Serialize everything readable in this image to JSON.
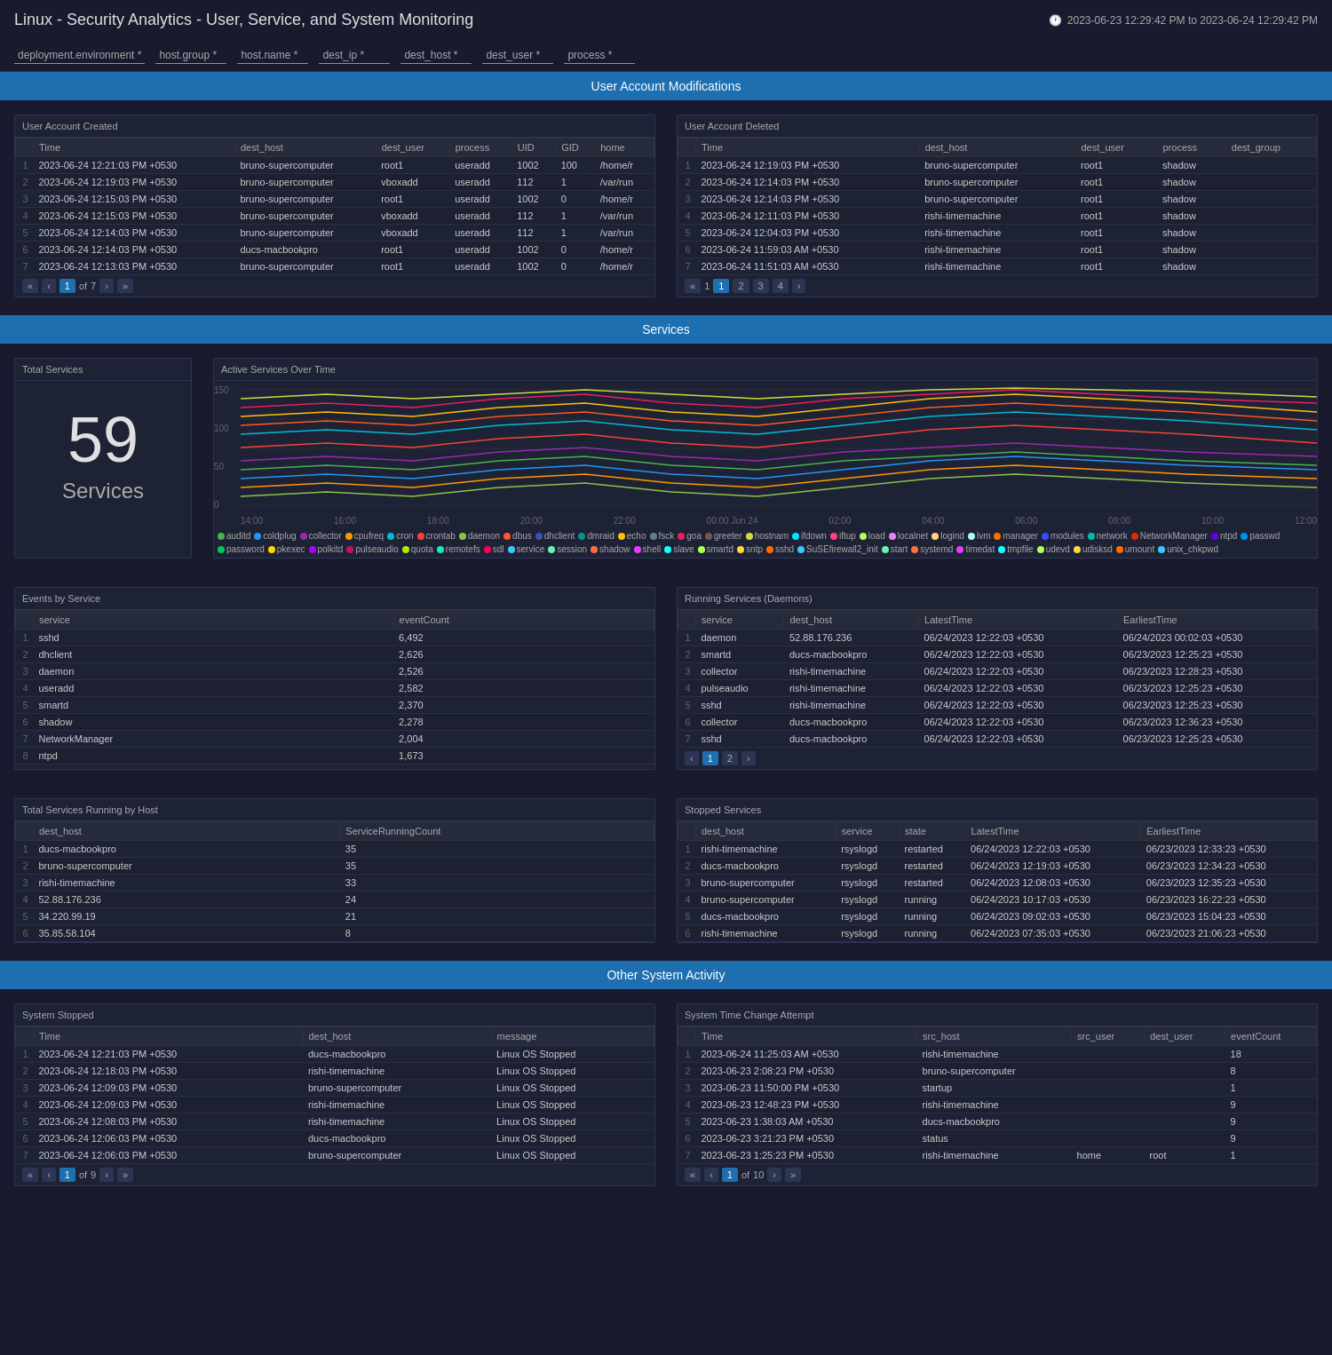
{
  "header": {
    "title": "Linux - Security Analytics - User, Service, and System Monitoring",
    "time_range": "2023-06-23 12:29:42 PM to 2023-06-24 12:29:42 PM"
  },
  "filters": [
    {
      "label": "deployment.environment *",
      "value": ""
    },
    {
      "label": "host.group *",
      "value": ""
    },
    {
      "label": "host.name *",
      "value": ""
    },
    {
      "label": "dest_ip *",
      "value": ""
    },
    {
      "label": "dest_host *",
      "value": ""
    },
    {
      "label": "dest_user *",
      "value": ""
    },
    {
      "label": "process *",
      "value": ""
    }
  ],
  "sections": {
    "user_account": {
      "title": "User Account Modifications",
      "created": {
        "title": "User Account Created",
        "columns": [
          "Time",
          "dest_host",
          "dest_user",
          "process",
          "UID",
          "GID",
          "home"
        ],
        "rows": [
          [
            "2023-06-24 12:21:03 PM +0530",
            "bruno-supercomputer",
            "root1",
            "useradd",
            "1002",
            "100",
            "/home/r"
          ],
          [
            "2023-06-24 12:19:03 PM +0530",
            "bruno-supercomputer",
            "vboxadd",
            "useradd",
            "112",
            "1",
            "/var/run"
          ],
          [
            "2023-06-24 12:15:03 PM +0530",
            "bruno-supercomputer",
            "root1",
            "useradd",
            "1002",
            "0",
            "/home/r"
          ],
          [
            "2023-06-24 12:15:03 PM +0530",
            "bruno-supercomputer",
            "vboxadd",
            "useradd",
            "112",
            "1",
            "/var/run"
          ],
          [
            "2023-06-24 12:14:03 PM +0530",
            "bruno-supercomputer",
            "vboxadd",
            "useradd",
            "112",
            "1",
            "/var/run"
          ],
          [
            "2023-06-24 12:14:03 PM +0530",
            "ducs-macbookpro",
            "root1",
            "useradd",
            "1002",
            "0",
            "/home/r"
          ],
          [
            "2023-06-24 12:13:03 PM +0530",
            "bruno-supercomputer",
            "root1",
            "useradd",
            "1002",
            "0",
            "/home/r"
          ]
        ],
        "pagination": {
          "current": 1,
          "total": 7
        }
      },
      "deleted": {
        "title": "User Account Deleted",
        "columns": [
          "Time",
          "dest_host",
          "dest_user",
          "process",
          "dest_group"
        ],
        "rows": [
          [
            "2023-06-24 12:19:03 PM +0530",
            "bruno-supercomputer",
            "root1",
            "shadow",
            ""
          ],
          [
            "2023-06-24 12:14:03 PM +0530",
            "bruno-supercomputer",
            "root1",
            "shadow",
            ""
          ],
          [
            "2023-06-24 12:14:03 PM +0530",
            "bruno-supercomputer",
            "root1",
            "shadow",
            ""
          ],
          [
            "2023-06-24 12:11:03 PM +0530",
            "rishi-timemachine",
            "root1",
            "shadow",
            ""
          ],
          [
            "2023-06-24 12:04:03 PM +0530",
            "rishi-timemachine",
            "root1",
            "shadow",
            ""
          ],
          [
            "2023-06-24 11:59:03 AM +0530",
            "rishi-timemachine",
            "root1",
            "shadow",
            ""
          ],
          [
            "2023-06-24 11:51:03 AM +0530",
            "rishi-timemachine",
            "root1",
            "shadow",
            ""
          ]
        ],
        "pagination": {
          "current": 1,
          "total": 4
        }
      }
    },
    "services": {
      "title": "Services",
      "total_count": "59",
      "total_label": "Services",
      "chart": {
        "title": "Active Services Over Time",
        "y_labels": [
          "150",
          "100",
          "50",
          "0"
        ],
        "x_labels": [
          "14:00",
          "16:00",
          "18:00",
          "20:00",
          "22:00",
          "00:00 Jun 24",
          "02:00",
          "04:00",
          "06:00",
          "08:00",
          "10:00",
          "12:00"
        ],
        "legend": [
          {
            "name": "auditd",
            "color": "#4CAF50"
          },
          {
            "name": "coldplug",
            "color": "#2196F3"
          },
          {
            "name": "collector",
            "color": "#9C27B0"
          },
          {
            "name": "cpufreq",
            "color": "#FF9800"
          },
          {
            "name": "cron",
            "color": "#00BCD4"
          },
          {
            "name": "crontab",
            "color": "#F44336"
          },
          {
            "name": "daemon",
            "color": "#8BC34A"
          },
          {
            "name": "dbus",
            "color": "#FF5722"
          },
          {
            "name": "dhclient",
            "color": "#3F51B5"
          },
          {
            "name": "dmraid",
            "color": "#009688"
          },
          {
            "name": "echo",
            "color": "#FFC107"
          },
          {
            "name": "fsck",
            "color": "#607D8B"
          },
          {
            "name": "goa",
            "color": "#E91E63"
          },
          {
            "name": "greeter",
            "color": "#795548"
          },
          {
            "name": "hostnam",
            "color": "#CDDC39"
          },
          {
            "name": "ifdown",
            "color": "#00E5FF"
          },
          {
            "name": "iftup",
            "color": "#FF4081"
          },
          {
            "name": "load",
            "color": "#B2FF59"
          },
          {
            "name": "localnet",
            "color": "#EA80FC"
          },
          {
            "name": "logind",
            "color": "#FFD180"
          },
          {
            "name": "lvm",
            "color": "#A7FFEB"
          },
          {
            "name": "manager",
            "color": "#FF6D00"
          },
          {
            "name": "modules",
            "color": "#304FFE"
          },
          {
            "name": "network",
            "color": "#00BFA5"
          },
          {
            "name": "NetworkManager",
            "color": "#DD2C00"
          },
          {
            "name": "ntpd",
            "color": "#6200EA"
          },
          {
            "name": "passwd",
            "color": "#0091EA"
          },
          {
            "name": "password",
            "color": "#00C853"
          },
          {
            "name": "pkexec",
            "color": "#FFD600"
          },
          {
            "name": "polkitd",
            "color": "#AA00FF"
          },
          {
            "name": "pulseaudio",
            "color": "#C51162"
          },
          {
            "name": "quota",
            "color": "#AEEA00"
          },
          {
            "name": "remotefs",
            "color": "#1DE9B6"
          },
          {
            "name": "sdl",
            "color": "#F50057"
          },
          {
            "name": "service",
            "color": "#40C4FF"
          },
          {
            "name": "session",
            "color": "#69F0AE"
          },
          {
            "name": "shadow",
            "color": "#FF6E40"
          },
          {
            "name": "shell",
            "color": "#E040FB"
          },
          {
            "name": "slave",
            "color": "#18FFFF"
          },
          {
            "name": "smartd",
            "color": "#B0FF57"
          },
          {
            "name": "sntp",
            "color": "#FFD740"
          },
          {
            "name": "sshd",
            "color": "#FF6D00"
          },
          {
            "name": "SuSEfirewall2_init",
            "color": "#40C4FF"
          },
          {
            "name": "start",
            "color": "#69F0AE"
          },
          {
            "name": "systemd",
            "color": "#FF6E40"
          },
          {
            "name": "timedat",
            "color": "#E040FB"
          },
          {
            "name": "tmpfile",
            "color": "#18FFFF"
          },
          {
            "name": "udevd",
            "color": "#B0FF57"
          },
          {
            "name": "udisksd",
            "color": "#FFD740"
          },
          {
            "name": "umount",
            "color": "#FF6D00"
          },
          {
            "name": "unix_chkpwd",
            "color": "#40C4FF"
          }
        ]
      },
      "events_by_service": {
        "title": "Events by Service",
        "columns": [
          "service",
          "eventCount"
        ],
        "rows": [
          [
            "sshd",
            "6,492"
          ],
          [
            "dhclient",
            "2,626"
          ],
          [
            "daemon",
            "2,526"
          ],
          [
            "useradd",
            "2,582"
          ],
          [
            "smartd",
            "2,370"
          ],
          [
            "shadow",
            "2,278"
          ],
          [
            "NetworkManager",
            "2,004"
          ],
          [
            "ntpd",
            "1,673"
          ]
        ]
      },
      "running_services": {
        "title": "Running Services (Daemons)",
        "columns": [
          "service",
          "dest_host",
          "LatestTime",
          "EarliestTime"
        ],
        "rows": [
          [
            "daemon",
            "52.88.176.236",
            "06/24/2023 12:22:03 +0530",
            "06/24/2023 00:02:03 +0530"
          ],
          [
            "smartd",
            "ducs-macbookpro",
            "06/24/2023 12:22:03 +0530",
            "06/23/2023 12:25:23 +0530"
          ],
          [
            "collector",
            "rishi-timemachine",
            "06/24/2023 12:22:03 +0530",
            "06/23/2023 12:28:23 +0530"
          ],
          [
            "pulseaudio",
            "rishi-timemachine",
            "06/24/2023 12:22:03 +0530",
            "06/23/2023 12:25:23 +0530"
          ],
          [
            "sshd",
            "rishi-timemachine",
            "06/24/2023 12:22:03 +0530",
            "06/23/2023 12:25:23 +0530"
          ],
          [
            "collector",
            "ducs-macbookpro",
            "06/24/2023 12:22:03 +0530",
            "06/23/2023 12:36:23 +0530"
          ],
          [
            "sshd",
            "ducs-macbookpro",
            "06/24/2023 12:22:03 +0530",
            "06/23/2023 12:25:23 +0530"
          ]
        ],
        "pagination": {
          "current": 1,
          "total": 2
        }
      },
      "running_by_host": {
        "title": "Total Services Running by Host",
        "columns": [
          "dest_host",
          "ServiceRunningCount"
        ],
        "rows": [
          [
            "ducs-macbookpro",
            "35"
          ],
          [
            "bruno-supercomputer",
            "35"
          ],
          [
            "rishi-timemachine",
            "33"
          ],
          [
            "52.88.176.236",
            "24"
          ],
          [
            "34.220.99.19",
            "21"
          ],
          [
            "35.85.58.104",
            "8"
          ]
        ]
      },
      "stopped_services": {
        "title": "Stopped Services",
        "columns": [
          "dest_host",
          "service",
          "state",
          "LatestTime",
          "EarliestTime"
        ],
        "rows": [
          [
            "rishi-timemachine",
            "rsyslogd",
            "restarted",
            "06/24/2023 12:22:03 +0530",
            "06/23/2023 12:33:23 +0530"
          ],
          [
            "ducs-macbookpro",
            "rsyslogd",
            "restarted",
            "06/24/2023 12:19:03 +0530",
            "06/23/2023 12:34:23 +0530"
          ],
          [
            "bruno-supercomputer",
            "rsyslogd",
            "restarted",
            "06/24/2023 12:08:03 +0530",
            "06/23/2023 12:35:23 +0530"
          ],
          [
            "bruno-supercomputer",
            "rsyslogd",
            "running",
            "06/24/2023 10:17:03 +0530",
            "06/23/2023 16:22:23 +0530"
          ],
          [
            "ducs-macbookpro",
            "rsyslogd",
            "running",
            "06/24/2023 09:02:03 +0530",
            "06/23/2023 15:04:23 +0530"
          ],
          [
            "rishi-timemachine",
            "rsyslogd",
            "running",
            "06/24/2023 07:35:03 +0530",
            "06/23/2023 21:06:23 +0530"
          ]
        ]
      }
    },
    "other_activity": {
      "title": "Other System Activity",
      "system_stopped": {
        "title": "System Stopped",
        "columns": [
          "Time",
          "dest_host",
          "message"
        ],
        "rows": [
          [
            "2023-06-24 12:21:03 PM +0530",
            "ducs-macbookpro",
            "Linux OS Stopped"
          ],
          [
            "2023-06-24 12:18:03 PM +0530",
            "rishi-timemachine",
            "Linux OS Stopped"
          ],
          [
            "2023-06-24 12:09:03 PM +0530",
            "bruno-supercomputer",
            "Linux OS Stopped"
          ],
          [
            "2023-06-24 12:09:03 PM +0530",
            "rishi-timemachine",
            "Linux OS Stopped"
          ],
          [
            "2023-06-24 12:08:03 PM +0530",
            "rishi-timemachine",
            "Linux OS Stopped"
          ],
          [
            "2023-06-24 12:06:03 PM +0530",
            "ducs-macbookpro",
            "Linux OS Stopped"
          ],
          [
            "2023-06-24 12:06:03 PM +0530",
            "bruno-supercomputer",
            "Linux OS Stopped"
          ]
        ],
        "pagination": {
          "current": 1,
          "total": 9
        }
      },
      "time_change": {
        "title": "System Time Change Attempt",
        "columns": [
          "Time",
          "src_host",
          "src_user",
          "dest_user",
          "eventCount"
        ],
        "rows": [
          [
            "2023-06-24 11:25:03 AM +0530",
            "rishi-timemachine",
            "",
            "",
            "18"
          ],
          [
            "2023-06-23 2:08:23 PM +0530",
            "bruno-supercomputer",
            "",
            "",
            "8"
          ],
          [
            "2023-06-23 11:50:00 PM +0530",
            "startup",
            "",
            "",
            "1"
          ],
          [
            "2023-06-23 12:48:23 PM +0530",
            "rishi-timemachine",
            "",
            "",
            "9"
          ],
          [
            "2023-06-23 1:38:03 AM +0530",
            "ducs-macbookpro",
            "",
            "",
            "9"
          ],
          [
            "2023-06-23 3:21:23 PM +0530",
            "status",
            "",
            "",
            "9"
          ],
          [
            "2023-06-23 1:25:23 PM +0530",
            "rishi-timemachine",
            "home",
            "root",
            "1"
          ]
        ],
        "pagination": {
          "current": 1,
          "total": 10
        }
      }
    }
  }
}
